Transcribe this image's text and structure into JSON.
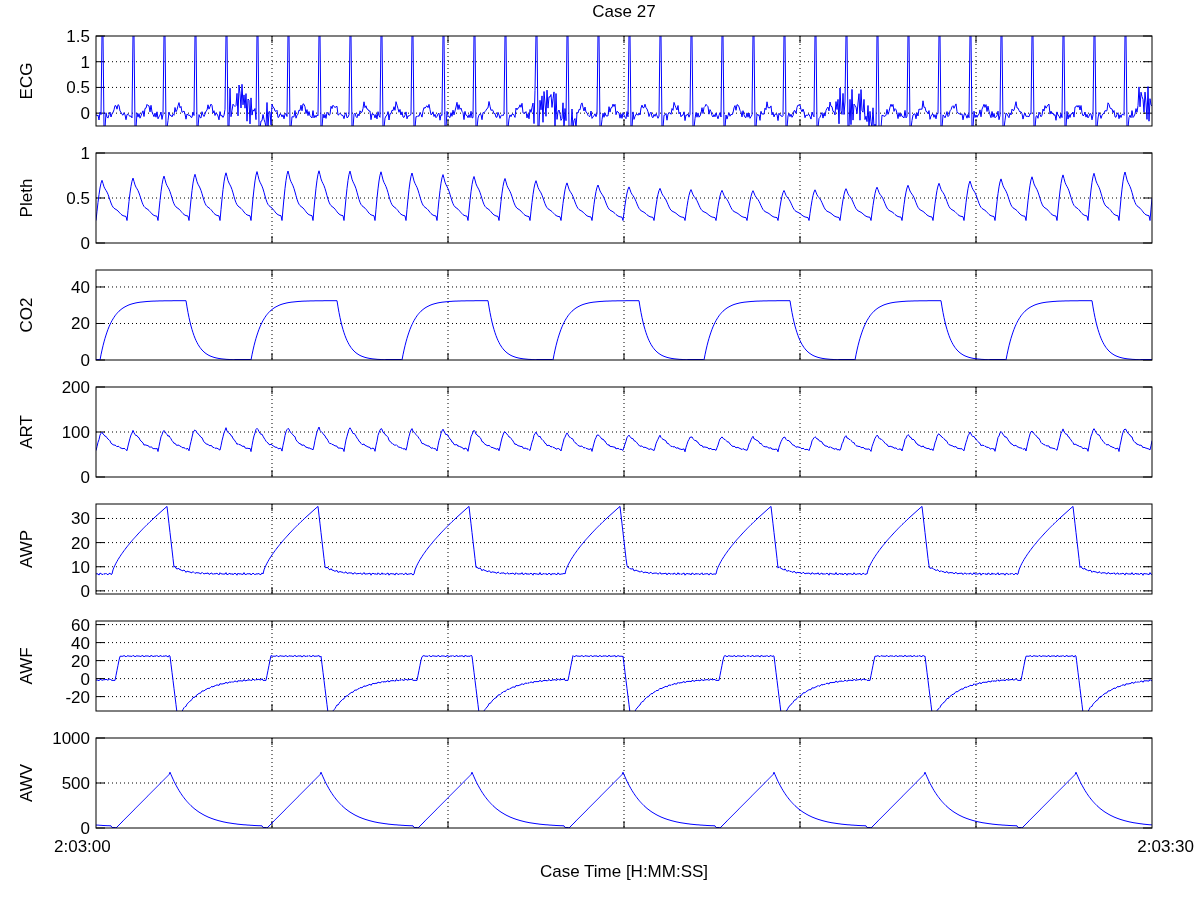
{
  "title": "Case 27",
  "panels": [
    {
      "label": "ECG",
      "kind": "ecg",
      "yticks": [
        "1.5",
        "1",
        "0.5",
        "0"
      ]
    },
    {
      "label": "Pleth",
      "kind": "pleth",
      "yticks": [
        "1",
        "0.5",
        "0"
      ]
    },
    {
      "label": "CO2",
      "kind": "co2",
      "yticks": [
        "40",
        "20",
        "0"
      ]
    },
    {
      "label": "ART",
      "kind": "art",
      "yticks": [
        "200",
        "100",
        "0"
      ]
    },
    {
      "label": "AWP",
      "kind": "awp",
      "yticks": [
        "30",
        "20",
        "10",
        "0"
      ]
    },
    {
      "label": "AWF",
      "kind": "awf",
      "yticks": [
        "60",
        "40",
        "20",
        "0",
        "-20"
      ]
    },
    {
      "label": "AWV",
      "kind": "awv",
      "yticks": [
        "1000",
        "500",
        "0"
      ]
    }
  ],
  "xticks": [
    "2:03:00",
    "2:03:30"
  ],
  "xlabel": "Case Time [H:MM:SS]"
}
